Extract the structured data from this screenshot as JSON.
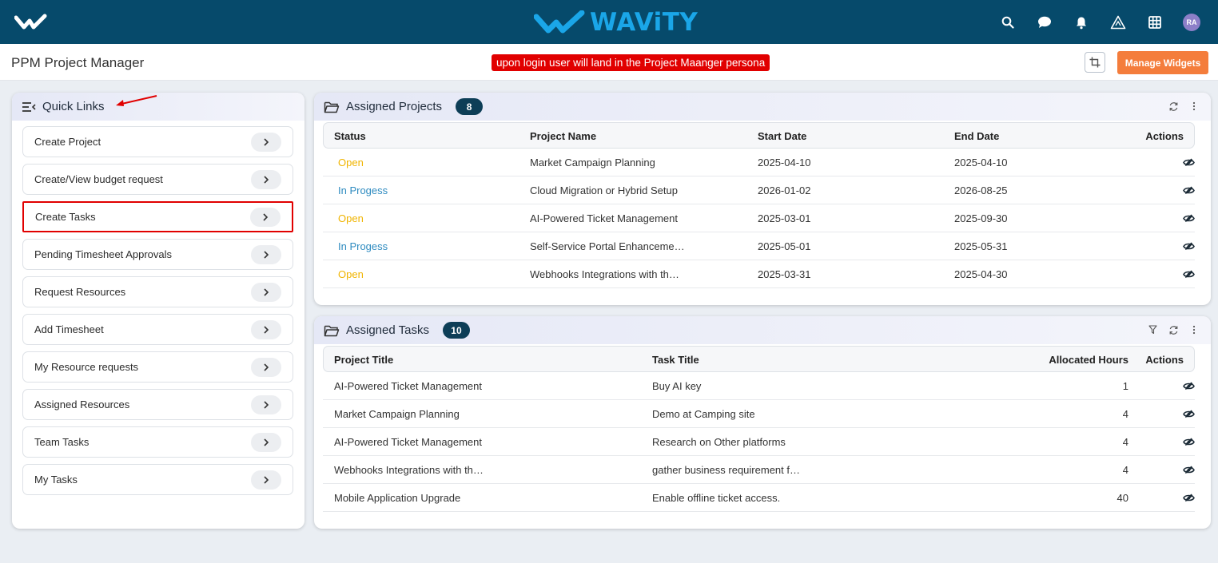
{
  "topbar": {
    "brand": "WAViTY",
    "avatar_initials": "RA",
    "icons": [
      "search-icon",
      "chat-icon",
      "bell-icon",
      "alert-triangle-icon",
      "grid-icon"
    ]
  },
  "subheader": {
    "page_title": "PPM Project Manager",
    "annotation": "upon login user will land in the Project Maanger persona",
    "manage_widgets": "Manage Widgets"
  },
  "quick_links": {
    "title": "Quick Links",
    "items": [
      {
        "label": "Create Project"
      },
      {
        "label": "Create/View budget request"
      },
      {
        "label": "Create Tasks"
      },
      {
        "label": "Pending Timesheet Approvals"
      },
      {
        "label": "Request Resources"
      },
      {
        "label": "Add Timesheet"
      },
      {
        "label": "My Resource requests"
      },
      {
        "label": "Assigned Resources"
      },
      {
        "label": "Team Tasks"
      },
      {
        "label": "My Tasks"
      }
    ]
  },
  "assigned_projects": {
    "title": "Assigned Projects",
    "count": "8",
    "columns": [
      "Status",
      "Project Name",
      "Start Date",
      "End Date",
      "Actions"
    ],
    "rows": [
      {
        "status": "Open",
        "name": "Market Campaign Planning",
        "start": "2025-04-10",
        "end": "2025-04-10"
      },
      {
        "status": "In Progess",
        "name": "Cloud Migration or Hybrid Setup",
        "start": "2026-01-02",
        "end": "2026-08-25"
      },
      {
        "status": "Open",
        "name": "AI-Powered Ticket Management",
        "start": "2025-03-01",
        "end": "2025-09-30"
      },
      {
        "status": "In Progess",
        "name": "Self-Service Portal Enhanceme…",
        "start": "2025-05-01",
        "end": "2025-05-31"
      },
      {
        "status": "Open",
        "name": "Webhooks Integrations with th…",
        "start": "2025-03-31",
        "end": "2025-04-30"
      }
    ]
  },
  "assigned_tasks": {
    "title": "Assigned Tasks",
    "count": "10",
    "columns": [
      "Project Title",
      "Task Title",
      "Allocated Hours",
      "Actions"
    ],
    "rows": [
      {
        "project": "AI-Powered Ticket Management",
        "task": "Buy AI key",
        "hours": "1"
      },
      {
        "project": "Market Campaign Planning",
        "task": "Demo at Camping site",
        "hours": "4"
      },
      {
        "project": "AI-Powered Ticket Management",
        "task": "Research on Other platforms",
        "hours": "4"
      },
      {
        "project": "Webhooks Integrations with th…",
        "task": "gather business requirement f…",
        "hours": "4"
      },
      {
        "project": "Mobile Application Upgrade",
        "task": "Enable offline ticket access.",
        "hours": "40"
      }
    ]
  },
  "colors": {
    "topbar": "#064a6b",
    "brand": "#1aa6e8",
    "manage_button": "#f47d3c",
    "status_open": "#f0b400",
    "status_in_progress": "#2e8bc0",
    "badge": "#0d3e57",
    "annotation": "#e10000"
  }
}
